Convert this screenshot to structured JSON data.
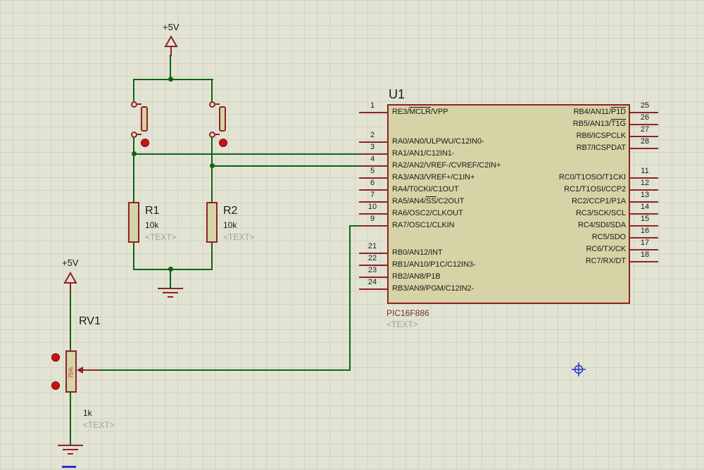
{
  "colors": {
    "background": "#e3e3d4",
    "grid": "#d3d3c2",
    "wire_green": "#0f640f",
    "component_maroon": "#8e2323",
    "component_fill": "#d6d3a6",
    "placeholder_gray": "#a0a095",
    "marker_blue": "#2233cc",
    "actuator_red": "#cc1111"
  },
  "chip": {
    "ref": "U1",
    "part": "PIC16F886",
    "placeholder": "<TEXT>",
    "left_pins": [
      {
        "num": "1",
        "pre": "RE3/",
        "over": "MCLR",
        "post": "/VPP"
      },
      {
        "num": "2",
        "pre": "RA0/AN0/ULPWU/C12IN0-",
        "over": "",
        "post": ""
      },
      {
        "num": "3",
        "pre": "RA1/AN1/C12IN1-",
        "over": "",
        "post": ""
      },
      {
        "num": "4",
        "pre": "RA2/AN2/VREF-/CVREF/C2IN+",
        "over": "",
        "post": ""
      },
      {
        "num": "5",
        "pre": "RA3/AN3/VREF+/C1IN+",
        "over": "",
        "post": ""
      },
      {
        "num": "6",
        "pre": "RA4/T0CKI/C1OUT",
        "over": "",
        "post": ""
      },
      {
        "num": "7",
        "pre": "RA5/AN4/",
        "over": "SS",
        "post": "/C2OUT"
      },
      {
        "num": "10",
        "pre": "RA6/OSC2/CLKOUT",
        "over": "",
        "post": ""
      },
      {
        "num": "9",
        "pre": "RA7/OSC1/CLKIN",
        "over": "",
        "post": ""
      },
      {
        "num": "21",
        "pre": "RB0/AN12/INT",
        "over": "",
        "post": ""
      },
      {
        "num": "22",
        "pre": "RB1/AN10/P1C/C12IN3-",
        "over": "",
        "post": ""
      },
      {
        "num": "23",
        "pre": "RB2/AN8/P1B",
        "over": "",
        "post": ""
      },
      {
        "num": "24",
        "pre": "RB3/AN9/PGM/C12IN2-",
        "over": "",
        "post": ""
      }
    ],
    "right_pins": [
      {
        "num": "25",
        "pre": "RB4/AN11/",
        "over": "P1D",
        "post": ""
      },
      {
        "num": "26",
        "pre": "RB5/AN13/",
        "over": "T1G",
        "post": ""
      },
      {
        "num": "27",
        "pre": "RB6/ICSPCLK",
        "over": "",
        "post": ""
      },
      {
        "num": "28",
        "pre": "RB7/ICSPDAT",
        "over": "",
        "post": ""
      },
      {
        "num": "11",
        "pre": "RC0/T1OSO/T1CKI",
        "over": "",
        "post": ""
      },
      {
        "num": "12",
        "pre": "RC1/T1OSI/CCP2",
        "over": "",
        "post": ""
      },
      {
        "num": "13",
        "pre": "RC2/CCP1/P1A",
        "over": "",
        "post": ""
      },
      {
        "num": "14",
        "pre": "RC3/SCK/SCL",
        "over": "",
        "post": ""
      },
      {
        "num": "15",
        "pre": "RC4/SDI/SDA",
        "over": "",
        "post": ""
      },
      {
        "num": "16",
        "pre": "RC5/SDO",
        "over": "",
        "post": ""
      },
      {
        "num": "17",
        "pre": "RC6/TX/CK",
        "over": "",
        "post": ""
      },
      {
        "num": "18",
        "pre": "RC7/RX/DT",
        "over": "",
        "post": ""
      }
    ]
  },
  "power": {
    "top_label": "+5V",
    "bottom_label": "+5V"
  },
  "resistors": [
    {
      "ref": "R1",
      "value": "10k",
      "placeholder": "<TEXT>"
    },
    {
      "ref": "R2",
      "value": "10k",
      "placeholder": "<TEXT>"
    }
  ],
  "potentiometer": {
    "ref": "RV1",
    "value": "1k",
    "placeholder": "<TEXT>",
    "percent": "75%"
  }
}
